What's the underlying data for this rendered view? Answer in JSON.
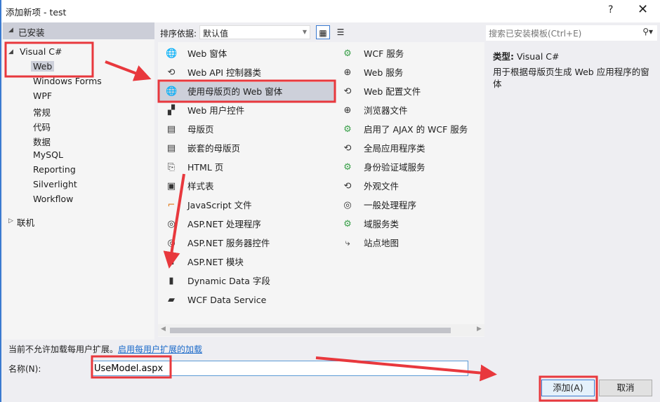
{
  "window": {
    "title": "添加新项 - test",
    "help_label": "?",
    "close_label": "✕"
  },
  "left": {
    "installed": "已安装",
    "tree": [
      {
        "label": "Visual C#",
        "expanded": true
      },
      {
        "label": "Web",
        "selected": true
      },
      {
        "label": "Windows Forms"
      },
      {
        "label": "WPF"
      },
      {
        "label": "常规"
      },
      {
        "label": "代码"
      },
      {
        "label": "数据"
      },
      {
        "label": "MySQL"
      },
      {
        "label": "Reporting"
      },
      {
        "label": "Silverlight"
      },
      {
        "label": "Workflow"
      },
      {
        "label": "联机",
        "expanded": false
      }
    ]
  },
  "toolbar": {
    "sort_label": "排序依据:",
    "sort_value": "默认值"
  },
  "search": {
    "placeholder": "搜索已安装模板(Ctrl+E)"
  },
  "templates_col1": [
    {
      "label": "Web 窗体",
      "icon": "globe-icon"
    },
    {
      "label": "Web API 控制器类",
      "icon": "web-api-icon"
    },
    {
      "label": "使用母版页的 Web 窗体",
      "icon": "globe-icon",
      "selected": true
    },
    {
      "label": "Web 用户控件",
      "icon": "user-control-icon"
    },
    {
      "label": "母版页",
      "icon": "master-page-icon"
    },
    {
      "label": "嵌套的母版页",
      "icon": "nested-master-page-icon"
    },
    {
      "label": "HTML 页",
      "icon": "html-page-icon"
    },
    {
      "label": "样式表",
      "icon": "stylesheet-icon"
    },
    {
      "label": "JavaScript 文件",
      "icon": "javascript-icon"
    },
    {
      "label": "ASP.NET 处理程序",
      "icon": "handler-icon"
    },
    {
      "label": "ASP.NET 服务器控件",
      "icon": "server-control-icon"
    },
    {
      "label": "ASP.NET 模块",
      "icon": "module-icon"
    },
    {
      "label": "Dynamic Data 字段",
      "icon": "dynamic-data-icon"
    },
    {
      "label": "WCF Data Service",
      "icon": "data-service-icon"
    }
  ],
  "templates_col2": [
    {
      "label": "WCF 服务",
      "icon": "wcf-icon"
    },
    {
      "label": "Web 服务",
      "icon": "web-service-icon"
    },
    {
      "label": "Web 配置文件",
      "icon": "config-icon"
    },
    {
      "label": "浏览器文件",
      "icon": "browser-file-icon"
    },
    {
      "label": "启用了 AJAX 的 WCF 服务",
      "icon": "wcf-icon"
    },
    {
      "label": "全局应用程序类",
      "icon": "global-app-icon"
    },
    {
      "label": "身份验证域服务",
      "icon": "wcf-icon"
    },
    {
      "label": "外观文件",
      "icon": "skin-file-icon"
    },
    {
      "label": "一般处理程序",
      "icon": "generic-handler-icon"
    },
    {
      "label": "域服务类",
      "icon": "wcf-icon"
    },
    {
      "label": "站点地图",
      "icon": "sitemap-icon"
    }
  ],
  "details": {
    "type_label": "类型:",
    "type_value": "Visual C#",
    "description": "用于根据母版页生成 Web 应用程序的窗体"
  },
  "bottom": {
    "notice": "当前不允许加载每用户扩展。",
    "enable_link": "启用每用户扩展的加载",
    "name_label": "名称(N):",
    "name_value": "UseModel.aspx",
    "add_label": "添加(A)",
    "cancel_label": "取消"
  },
  "colors": {
    "annotation": "#e8383d",
    "link": "#1b6ac9",
    "selection": "#cdd0da"
  }
}
